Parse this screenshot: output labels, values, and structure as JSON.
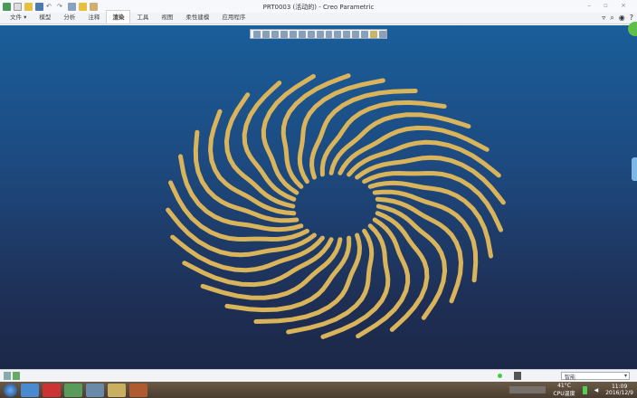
{
  "window": {
    "title": "PRT0003 (活动的) - Creo Parametric",
    "controls": "– ▫ ×"
  },
  "ribbon": {
    "tabs": [
      "文件 ▾",
      "模型",
      "分析",
      "注释",
      "渲染",
      "工具",
      "视图",
      "柔性建模",
      "应用程序"
    ],
    "active": 4
  },
  "status": {
    "filter": "智能"
  },
  "taskbar": {
    "temp": "41°C",
    "temp_label": "CPU温度",
    "time": "11:09",
    "date": "2016/12/9"
  },
  "colors": {
    "model": "#d9b45a",
    "bg_top": "#1a5e9a",
    "bg_bottom": "#1c2748"
  }
}
